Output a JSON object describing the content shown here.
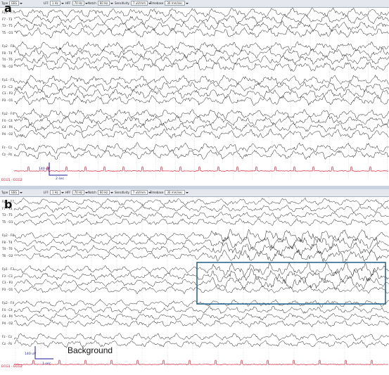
{
  "panels": [
    {
      "letter": "a",
      "toolbar": [
        {
          "label": "Type",
          "value": "EEG"
        },
        {
          "label": "LFF",
          "value": "1 Hz"
        },
        {
          "label": "HFF",
          "value": "70 Hz"
        },
        {
          "label": "Notch",
          "value": "60 Hz"
        },
        {
          "label": "Sensitivity",
          "value": "7 uV/mm"
        },
        {
          "label": "Timebase",
          "value": "30 mm/sec"
        }
      ],
      "channels": [
        "Fp1 - F7",
        "F7 - T3",
        "T3 - T5",
        "T5 - O1",
        "",
        "Fp2 - F8",
        "F8 - T4",
        "T4 - T6",
        "T6 - O2",
        "",
        "Fp1 - F3",
        "F3 - C3",
        "C3 - P3",
        "P3 - O1",
        "",
        "Fp2 - F4",
        "F4 - C4",
        "C4 - P4",
        "P4 - O2",
        "",
        "Fz - Cz",
        "Cz - Pz"
      ],
      "scale_amplitude": "140 uV",
      "scale_time": "2 sec",
      "ecg_label": "ECG1 - ECG2",
      "annotation": ""
    },
    {
      "letter": "b",
      "toolbar": [
        {
          "label": "Type",
          "value": "EEG"
        },
        {
          "label": "LFF",
          "value": "1 Hz"
        },
        {
          "label": "HFF",
          "value": "70 Hz"
        },
        {
          "label": "Notch",
          "value": "60 Hz"
        },
        {
          "label": "Sensitivity",
          "value": "7 uV/mm"
        },
        {
          "label": "Timebase",
          "value": "30 mm/sec"
        }
      ],
      "channels": [
        "Fp1 - F7",
        "F7 - T3",
        "T3 - T5",
        "T5 - O1",
        "",
        "Fp2 - F8",
        "F8 - T4",
        "T4 - T6",
        "T6 - O2",
        "",
        "Fp1 - F3",
        "F3 - C3",
        "C3 - P3",
        "P3 - O1",
        "",
        "Fp2 - F4",
        "F4 - C4",
        "C4 - P4",
        "P4 - O2",
        "",
        "Fz - Cz",
        "Cz - Pz"
      ],
      "scale_amplitude": "140 uV",
      "scale_time": "1 sec",
      "ecg_label": "ECG1 - ECG2",
      "annotation": "Background"
    }
  ],
  "colors": {
    "trace": "#1a1a1a",
    "ecg": "#d2001a",
    "scale_bar": "#1a1a9a",
    "highlight_box": "#1f5f86",
    "gridline": "#b9b9b9"
  }
}
